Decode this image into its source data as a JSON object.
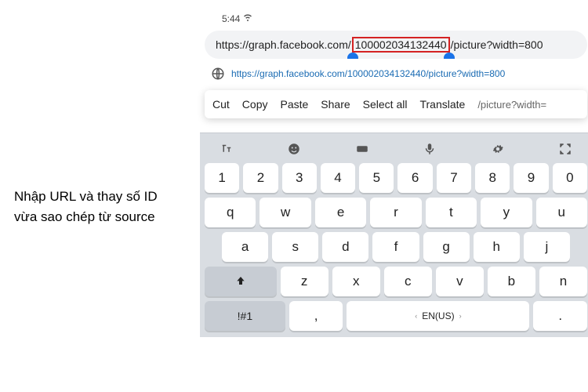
{
  "caption": {
    "line1": "Nhập URL và thay số ID",
    "line2": "vừa sao chép từ source"
  },
  "status": {
    "time": "5:44",
    "wifi": "wifi"
  },
  "address": {
    "prefix": "https://graph.facebook.com/",
    "selected_id": "100002034132440",
    "suffix": "/picture?width=800"
  },
  "suggestion": {
    "url": "https://graph.facebook.com/100002034132440/picture?width=800"
  },
  "context_menu": {
    "cut": "Cut",
    "copy": "Copy",
    "paste": "Paste",
    "share": "Share",
    "select_all": "Select all",
    "translate": "Translate",
    "trailing_text": "/picture?width="
  },
  "keyboard": {
    "row_num": [
      "1",
      "2",
      "3",
      "4",
      "5",
      "6",
      "7",
      "8",
      "9",
      "0"
    ],
    "row_q": [
      "q",
      "w",
      "e",
      "r",
      "t",
      "y",
      "u"
    ],
    "row_a": [
      "a",
      "s",
      "d",
      "f",
      "g",
      "h",
      "j"
    ],
    "row_z": [
      "z",
      "x",
      "c",
      "v",
      "b",
      "n"
    ],
    "sym_key": "!#1",
    "comma": ",",
    "space_lang": "EN(US)",
    "period": "."
  }
}
